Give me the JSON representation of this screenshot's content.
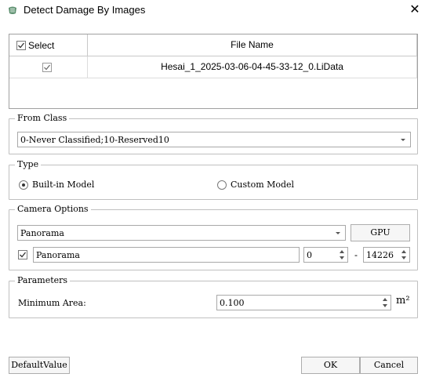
{
  "window": {
    "title": "Detect Damage By Images",
    "icon": "app-logo-icon",
    "close_icon": "close-icon"
  },
  "file_table": {
    "select_header": "Select",
    "filename_header": "File Name",
    "rows": [
      {
        "selected": true,
        "file_name": "Hesai_1_2025-03-06-04-45-33-12_0.LiData"
      }
    ]
  },
  "from_class": {
    "legend": "From Class",
    "value": "0-Never Classified;10-Reserved10"
  },
  "type": {
    "legend": "Type",
    "builtin_label": "Built-in Model",
    "custom_label": "Custom Model",
    "selected": "builtin"
  },
  "camera": {
    "legend": "Camera Options",
    "combo_value": "Panorama",
    "gpu_label": "GPU",
    "panorama_checked": true,
    "panorama_text": "Panorama",
    "range_start": "0",
    "range_dash": "-",
    "range_end": "14226"
  },
  "parameters": {
    "legend": "Parameters",
    "min_area_label": "Minimum Area:",
    "min_area_value": "0.100",
    "unit": "m²"
  },
  "footer": {
    "default_label": "DefaultValue",
    "ok_label": "OK",
    "cancel_label": "Cancel"
  }
}
